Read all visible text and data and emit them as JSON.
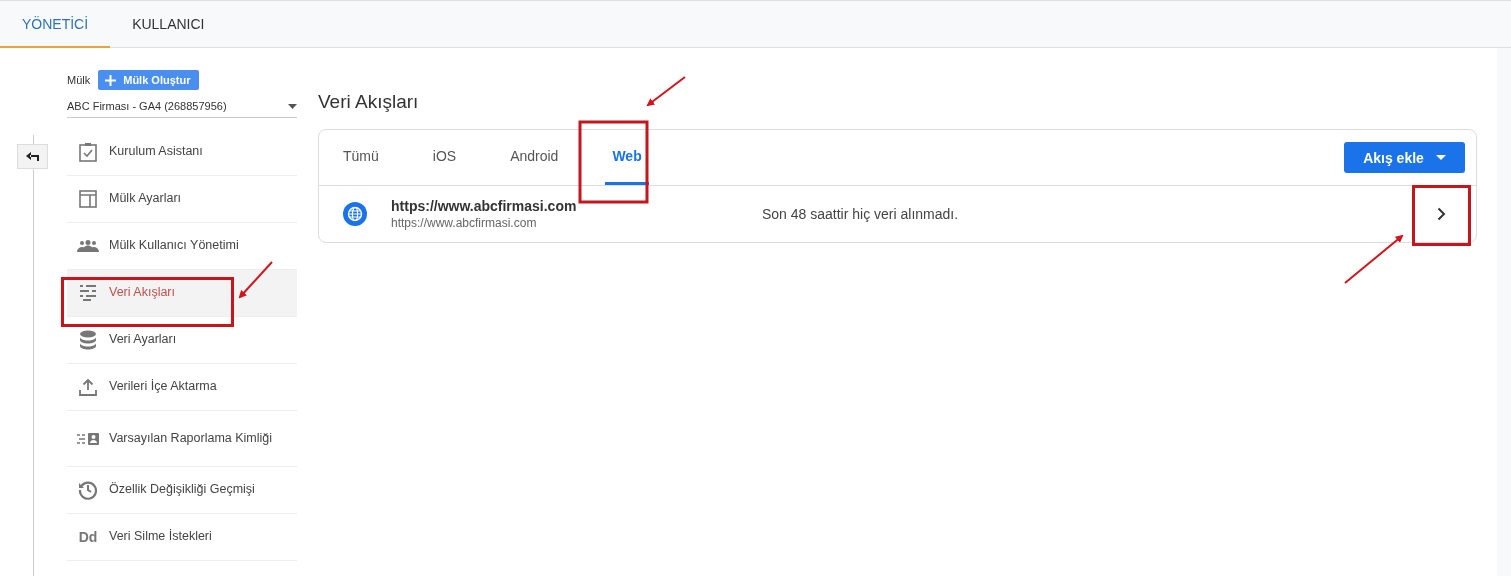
{
  "top_tabs": [
    {
      "label": "YÖNETİCİ",
      "selected": true
    },
    {
      "label": "KULLANICI",
      "selected": false
    }
  ],
  "property": {
    "label": "Mülk",
    "create_button": "Mülk Oluştur",
    "selector": "ABC Firması - GA4 (268857956)"
  },
  "nav": [
    {
      "kind": "checklist",
      "label": "Kurulum Asistanı",
      "selected": false
    },
    {
      "kind": "layout",
      "label": "Mülk Ayarları",
      "selected": false
    },
    {
      "kind": "people",
      "label": "Mülk Kullanıcı Yönetimi",
      "selected": false
    },
    {
      "kind": "streams",
      "label": "Veri Akışları",
      "selected": true
    },
    {
      "kind": "database",
      "label": "Veri Ayarları",
      "selected": false
    },
    {
      "kind": "upload",
      "label": "Verileri İçe Aktarma",
      "selected": false
    },
    {
      "kind": "identity",
      "label": "Varsayılan Raporlama Kimliği",
      "selected": false
    },
    {
      "kind": "history",
      "label": "Özellik Değişikliği Geçmişi",
      "selected": false
    },
    {
      "kind": "text",
      "icon_text": "Dd",
      "label": "Veri Silme İstekleri",
      "selected": false
    }
  ],
  "page_title": "Veri Akışları",
  "stream_tabs": [
    {
      "label": "Tümü",
      "selected": false
    },
    {
      "label": "iOS",
      "selected": false
    },
    {
      "label": "Android",
      "selected": false
    },
    {
      "label": "Web",
      "selected": true
    }
  ],
  "add_button": "Akış ekle",
  "streams": [
    {
      "title": "https://www.abcfirmasi.com",
      "url": "https://www.abcfirmasi.com",
      "status": "Son 48 saattir hiç veri alınmadı."
    }
  ]
}
